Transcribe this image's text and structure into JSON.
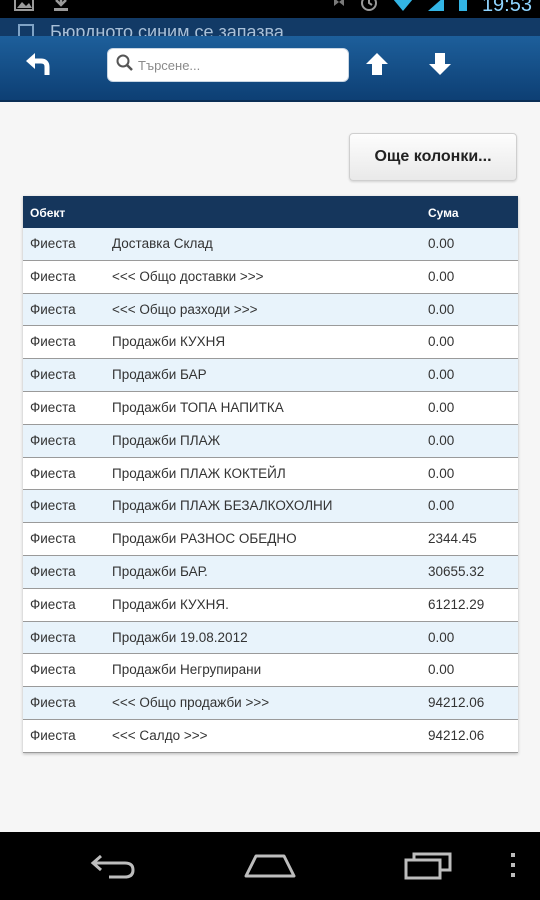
{
  "status_bar": {
    "time": "19:53",
    "icons": [
      "image-icon",
      "download-icon",
      "dropbox-icon",
      "alarm-icon",
      "wifi-icon",
      "signal-icon",
      "battery-icon"
    ]
  },
  "notification_peek": {
    "text": "Бюрдното синим се запазва"
  },
  "toolbar": {
    "search_placeholder": "Търсене...",
    "icons": [
      "back-icon",
      "search-icon",
      "arrow-up-icon",
      "arrow-down-icon"
    ]
  },
  "more_columns_label": "Още колонки...",
  "table": {
    "headers": [
      "Обект",
      "",
      "Сума"
    ],
    "rows": [
      [
        "Фиеста",
        "Доставка Склад",
        "0.00"
      ],
      [
        "Фиеста",
        "<<< Общо доставки >>>",
        "0.00"
      ],
      [
        "Фиеста",
        "<<< Общо разходи >>>",
        "0.00"
      ],
      [
        "Фиеста",
        "Продажби КУХНЯ",
        "0.00"
      ],
      [
        "Фиеста",
        "Продажби БАР",
        "0.00"
      ],
      [
        "Фиеста",
        "Продажби ТОПА НАПИТКА",
        "0.00"
      ],
      [
        "Фиеста",
        "Продажби ПЛАЖ",
        "0.00"
      ],
      [
        "Фиеста",
        "Продажби ПЛАЖ КОКТЕЙЛ",
        "0.00"
      ],
      [
        "Фиеста",
        "Продажби ПЛАЖ БЕЗАЛКОХОЛНИ",
        "0.00"
      ],
      [
        "Фиеста",
        "Продажби РАЗНОС ОБЕДНО",
        "2344.45"
      ],
      [
        "Фиеста",
        "Продажби БАР.",
        "30655.32"
      ],
      [
        "Фиеста",
        "Продажби КУХНЯ.",
        "61212.29"
      ],
      [
        "Фиеста",
        "Продажби 19.08.2012",
        "0.00"
      ],
      [
        "Фиеста",
        "Продажби Негрупирани",
        "0.00"
      ],
      [
        "Фиеста",
        "<<< Общо продажби >>>",
        "94212.06"
      ],
      [
        "Фиеста",
        "<<< Салдо >>>",
        "94212.06"
      ]
    ]
  },
  "nav_bar": {
    "icons": [
      "nav-back-icon",
      "nav-home-icon",
      "nav-recent-apps-icon",
      "overflow-menu-icon"
    ]
  },
  "colors": {
    "toolbar": "#0d3f74",
    "table_header": "#15365c",
    "row_alt": "#e8f3fb",
    "status_time": "#8fd4ff"
  }
}
